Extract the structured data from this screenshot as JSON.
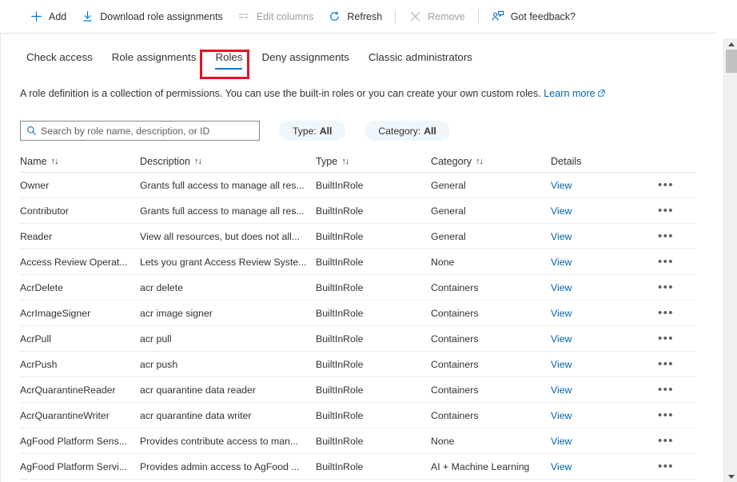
{
  "toolbar": {
    "items": [
      {
        "label": "Add",
        "icon": "plus-icon",
        "disabled": false,
        "sep_after": false
      },
      {
        "label": "Download role assignments",
        "icon": "download-icon",
        "disabled": false,
        "sep_after": false
      },
      {
        "label": "Edit columns",
        "icon": "columns-icon",
        "disabled": true,
        "sep_after": false
      },
      {
        "label": "Refresh",
        "icon": "refresh-icon",
        "disabled": false,
        "sep_after": true
      },
      {
        "label": "Remove",
        "icon": "close-x-icon",
        "disabled": true,
        "sep_after": true
      },
      {
        "label": "Got feedback?",
        "icon": "feedback-person-icon",
        "disabled": false,
        "sep_after": false
      }
    ]
  },
  "tabs": {
    "items": [
      {
        "label": "Check access",
        "active": false
      },
      {
        "label": "Role assignments",
        "active": false
      },
      {
        "label": "Roles",
        "active": true
      },
      {
        "label": "Deny assignments",
        "active": false
      },
      {
        "label": "Classic administrators",
        "active": false
      }
    ],
    "highlight_color": "#e81123",
    "active_underline_color": "#0078d4"
  },
  "description": {
    "text": "A role definition is a collection of permissions. You can use the built-in roles or you can create your own custom roles.",
    "link_label": "Learn more",
    "link_icon": "external-link-icon"
  },
  "search": {
    "placeholder": "Search by role name, description, or ID",
    "value": "",
    "icon": "search-icon"
  },
  "filters": [
    {
      "name": "Type",
      "separator": " : ",
      "value": "All"
    },
    {
      "name": "Category",
      "separator": " : ",
      "value": "All"
    }
  ],
  "table": {
    "columns": [
      {
        "key": "name",
        "label": "Name",
        "sortable": true,
        "sort_icon": "sort-updown-icon"
      },
      {
        "key": "description",
        "label": "Description",
        "sortable": true,
        "sort_icon": "sort-updown-icon"
      },
      {
        "key": "type",
        "label": "Type",
        "sortable": true,
        "sort_icon": "sort-updown-icon"
      },
      {
        "key": "category",
        "label": "Category",
        "sortable": true,
        "sort_icon": "sort-updown-icon"
      },
      {
        "key": "details",
        "label": "Details",
        "sortable": false,
        "sort_icon": ""
      }
    ],
    "details_link_label": "View",
    "row_menu_label": "•••",
    "rows": [
      {
        "name": "Owner",
        "description": "Grants full access to manage all res...",
        "type": "BuiltInRole",
        "category": "General"
      },
      {
        "name": "Contributor",
        "description": "Grants full access to manage all res...",
        "type": "BuiltInRole",
        "category": "General"
      },
      {
        "name": "Reader",
        "description": "View all resources, but does not all...",
        "type": "BuiltInRole",
        "category": "General"
      },
      {
        "name": "Access Review Operat...",
        "description": "Lets you grant Access Review Syste...",
        "type": "BuiltInRole",
        "category": "None"
      },
      {
        "name": "AcrDelete",
        "description": "acr delete",
        "type": "BuiltInRole",
        "category": "Containers"
      },
      {
        "name": "AcrImageSigner",
        "description": "acr image signer",
        "type": "BuiltInRole",
        "category": "Containers"
      },
      {
        "name": "AcrPull",
        "description": "acr pull",
        "type": "BuiltInRole",
        "category": "Containers"
      },
      {
        "name": "AcrPush",
        "description": "acr push",
        "type": "BuiltInRole",
        "category": "Containers"
      },
      {
        "name": "AcrQuarantineReader",
        "description": "acr quarantine data reader",
        "type": "BuiltInRole",
        "category": "Containers"
      },
      {
        "name": "AcrQuarantineWriter",
        "description": "acr quarantine data writer",
        "type": "BuiltInRole",
        "category": "Containers"
      },
      {
        "name": "AgFood Platform Sens...",
        "description": "Provides contribute access to man...",
        "type": "BuiltInRole",
        "category": "None"
      },
      {
        "name": "AgFood Platform Servi...",
        "description": "Provides admin access to AgFood ...",
        "type": "BuiltInRole",
        "category": "AI + Machine Learning"
      }
    ]
  },
  "scrollbar": {
    "up_icon": "scroll-up-arrow-icon",
    "down_icon": "scroll-down-arrow-icon",
    "thumb": "scrollbar-thumb"
  },
  "colors": {
    "accent": "#0078d4",
    "link": "#0063b1",
    "pill_bg": "#eff6fc",
    "highlight": "#e81123"
  }
}
